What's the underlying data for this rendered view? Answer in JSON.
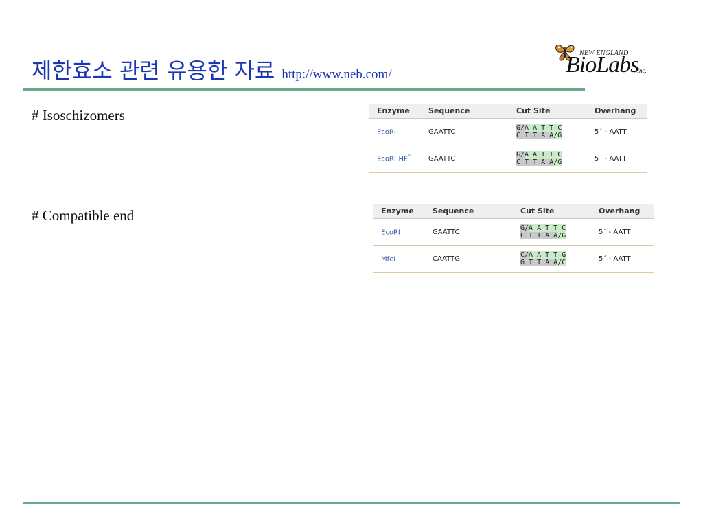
{
  "title": {
    "main": "제한효소 관련 유용한 자료",
    "url": "http://www.neb.com/"
  },
  "logo": {
    "top": "NEW ENGLAND",
    "main": "BioLabs",
    "suffix": "Inc.",
    "icon": "butterfly-icon"
  },
  "sections": [
    {
      "label": "# Isoschizomers"
    },
    {
      "label": "# Compatible end"
    }
  ],
  "tables": [
    {
      "headers": {
        "enzyme": "Enzyme",
        "sequence": "Sequence",
        "cut_site": "Cut Site",
        "overhang": "Overhang"
      },
      "rows": [
        {
          "enzyme": "EcoRI",
          "enzyme_sup": "",
          "sequence": "GAATTC",
          "top_pre": "G/",
          "top_post": "A A T T C",
          "bottom_pre": "C T T A A",
          "bottom_post": "/G",
          "overhang": "5´ - AATT"
        },
        {
          "enzyme": "EcoRI-HF",
          "enzyme_sup": "™",
          "sequence": "GAATTC",
          "top_pre": "G/",
          "top_post": "A A T T C",
          "bottom_pre": "C T T A A",
          "bottom_post": "/G",
          "overhang": "5´ - AATT"
        }
      ]
    },
    {
      "headers": {
        "enzyme": "Enzyme",
        "sequence": "Sequence",
        "cut_site": "Cut Site",
        "overhang": "Overhang"
      },
      "rows": [
        {
          "enzyme": "EcoRI",
          "enzyme_sup": "",
          "sequence": "GAATTC",
          "top_pre": "G/",
          "top_post": "A A T T C",
          "bottom_pre": "C T T A A",
          "bottom_post": "/G",
          "overhang": "5´ - AATT"
        },
        {
          "enzyme": "MfeI",
          "enzyme_sup": "",
          "sequence": "CAATTG",
          "top_pre": "C/",
          "top_post": "A A T T G",
          "bottom_pre": "G T T A A",
          "bottom_post": "/C",
          "overhang": "5´ - AATT"
        }
      ]
    }
  ],
  "colors": {
    "title": "#1b36b4",
    "rule": "#6aa888",
    "enzyme_link": "#3a5aa6",
    "cut_gray": "#c9c9c9",
    "cut_green": "#c8eac8"
  }
}
